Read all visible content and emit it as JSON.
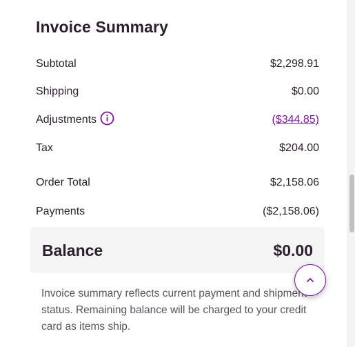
{
  "summary": {
    "title": "Invoice Summary",
    "rows": [
      {
        "label": "Subtotal",
        "value": "$2,298.91"
      },
      {
        "label": "Shipping",
        "value": "$0.00"
      },
      {
        "label": "Adjustments",
        "value": "($344.85)"
      },
      {
        "label": "Tax",
        "value": "$204.00"
      },
      {
        "label": "Order Total",
        "value": "$2,158.06"
      },
      {
        "label": "Payments",
        "value": "($2,158.06)"
      }
    ],
    "balance": {
      "label": "Balance",
      "value": "$0.00"
    },
    "note": "Invoice summary reflects current payment and shipment status. Remaining balance will be charged to your credit card as items ship."
  },
  "icons": {
    "info": "info-circle-icon",
    "back_to_top": "chevron-up-icon"
  },
  "colors": {
    "accent": "#7b189f",
    "text": "#2b1f2e",
    "muted_text": "#5c5160",
    "balance_bg": "#f5f5f5"
  }
}
